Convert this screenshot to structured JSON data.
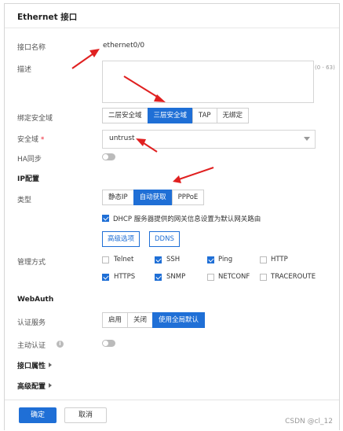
{
  "dialog": {
    "title": "Ethernet 接口"
  },
  "fields": {
    "interface_name_label": "接口名称",
    "interface_name_value": "ethernet0/0",
    "description_label": "描述",
    "description_value": "",
    "description_hint": "(0 - 63)",
    "bind_zone_label": "绑定安全域",
    "bind_zone_options": [
      "二层安全域",
      "三层安全域",
      "TAP",
      "无绑定"
    ],
    "bind_zone_selected": "三层安全域",
    "zone_label": "安全域",
    "zone_required_mark": "*",
    "zone_value": "untrust",
    "ha_sync_label": "HA同步",
    "ha_sync_on": false
  },
  "ip_config": {
    "section_title": "IP配置",
    "type_label": "类型",
    "type_options": [
      "静态IP",
      "自动获取",
      "PPPoE"
    ],
    "type_selected": "自动获取",
    "dhcp_checkbox_label": "DHCP 服务器提供的网关信息设置为默认网关路由",
    "dhcp_checked": true,
    "advanced_button": "高级选项",
    "ddns_button": "DDNS"
  },
  "management": {
    "label": "管理方式",
    "options": [
      {
        "name": "Telnet",
        "checked": false
      },
      {
        "name": "SSH",
        "checked": true
      },
      {
        "name": "Ping",
        "checked": true
      },
      {
        "name": "HTTP",
        "checked": false
      },
      {
        "name": "HTTPS",
        "checked": true
      },
      {
        "name": "SNMP",
        "checked": true
      },
      {
        "name": "NETCONF",
        "checked": false
      },
      {
        "name": "TRACEROUTE",
        "checked": false
      }
    ]
  },
  "webauth": {
    "section_title": "WebAuth",
    "auth_service_label": "认证服务",
    "auth_service_options": [
      "启用",
      "关闭",
      "使用全局默认"
    ],
    "auth_service_selected": "使用全局默认",
    "active_auth_label": "主动认证",
    "active_auth_on": false,
    "info_icon_glyph": "i"
  },
  "collapsibles": {
    "interface_attrs": "接口属性",
    "advanced_config": "高级配置"
  },
  "footer": {
    "ok_label": "确定",
    "cancel_label": "取消"
  },
  "watermark": "CSDN @cl_12",
  "colors": {
    "accent": "#1f6fd6",
    "annotation_arrow": "#e02020"
  }
}
